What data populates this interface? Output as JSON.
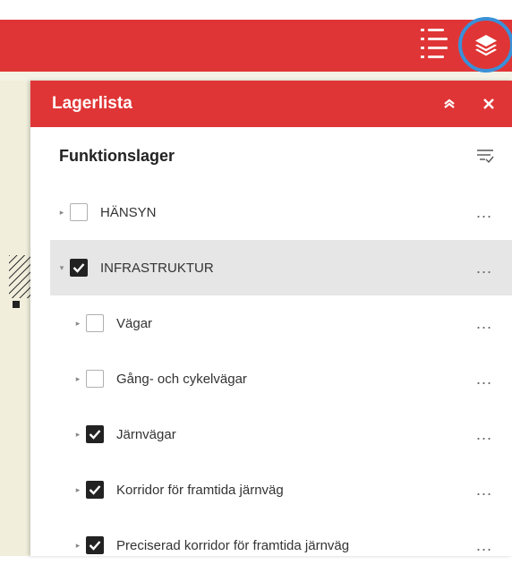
{
  "colors": {
    "brand_red": "#e03536",
    "highlight_ring": "#3a90d8",
    "selected_row": "#e6e6e6"
  },
  "toolbar": {
    "list_icon": "layer-list-icon",
    "layers_icon": "layers-icon"
  },
  "panel": {
    "title": "Lagerlista",
    "collapse_icon": "chevron-up-icon",
    "close_icon": "close-icon",
    "section_title": "Funktionslager",
    "filter_icon": "filter-icon",
    "layers": [
      {
        "label": "HÄNSYN",
        "checked": false,
        "expanded": false,
        "level": 0
      },
      {
        "label": "INFRASTRUKTUR",
        "checked": true,
        "expanded": true,
        "level": 0,
        "selected": true
      },
      {
        "label": "Vägar",
        "checked": false,
        "expanded": false,
        "level": 1
      },
      {
        "label": "Gång- och cykelvägar",
        "checked": false,
        "expanded": false,
        "level": 1
      },
      {
        "label": "Järnvägar",
        "checked": true,
        "expanded": false,
        "level": 1
      },
      {
        "label": "Korridor för framtida järnväg",
        "checked": true,
        "expanded": false,
        "level": 1
      },
      {
        "label": "Preciserad korridor för framtida järnväg",
        "checked": true,
        "expanded": false,
        "level": 1
      }
    ],
    "more_label": "..."
  }
}
